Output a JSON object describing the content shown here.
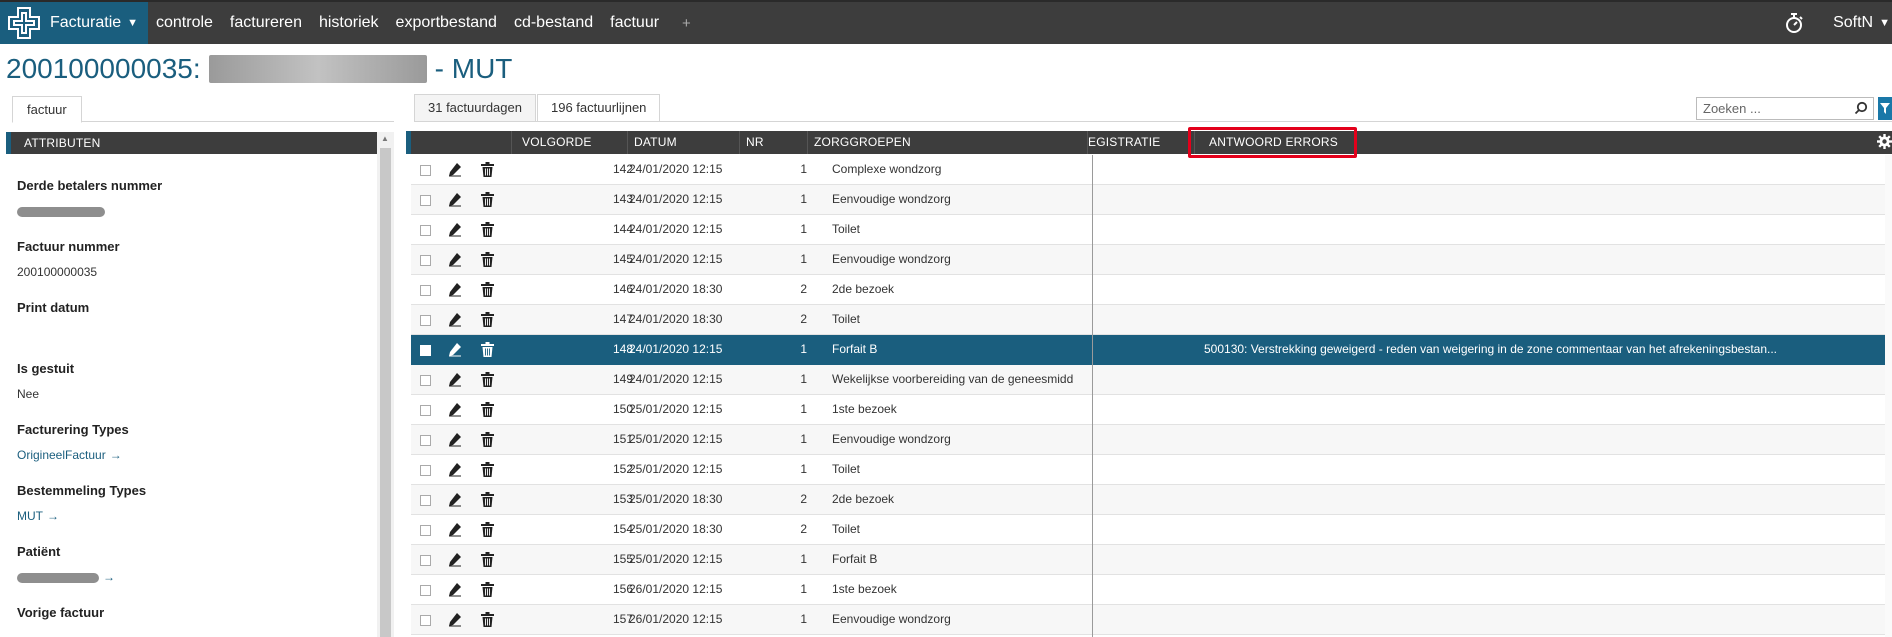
{
  "nav": {
    "brand": "Facturatie",
    "items": [
      "controle",
      "factureren",
      "historiek",
      "exportbestand",
      "cd-bestand",
      "factuur"
    ],
    "plus": "+",
    "user": "SoftN"
  },
  "title": {
    "prefix": "200100000035:",
    "suffix": "- MUT"
  },
  "left_panel": {
    "tab": "factuur",
    "section": "ATTRIBUTEN",
    "attributes": [
      {
        "label": "Derde betalers nummer",
        "value": "",
        "redacted": true
      },
      {
        "label": "Factuur nummer",
        "value": "200100000035"
      },
      {
        "label": "Print datum",
        "value": ""
      },
      {
        "label": "Is gestuit",
        "value": "Nee"
      },
      {
        "label": "Facturering Types",
        "value": "OrigineelFactuur",
        "link": true
      },
      {
        "label": "Bestemmeling Types",
        "value": "MUT",
        "link": true
      },
      {
        "label": "Patiënt",
        "value": "",
        "redacted": true,
        "link": true
      },
      {
        "label": "Vorige factuur",
        "value": ""
      }
    ]
  },
  "right_panel": {
    "tabs": [
      "31 factuurdagen",
      "196 factuurlijnen"
    ],
    "active_tab": 1,
    "search_placeholder": "Zoeken ...",
    "columns": [
      "VOLGORDE",
      "DATUM",
      "NR",
      "ZORGGROEPEN",
      "EGISTRATIE",
      "ANTWOORD ERRORS"
    ],
    "rows": [
      {
        "volgorde": "142",
        "datum": "24/01/2020 12:15",
        "nr": "1",
        "zorggroep": "Complexe wondzorg",
        "error": ""
      },
      {
        "volgorde": "143",
        "datum": "24/01/2020 12:15",
        "nr": "1",
        "zorggroep": "Eenvoudige wondzorg",
        "error": ""
      },
      {
        "volgorde": "144",
        "datum": "24/01/2020 12:15",
        "nr": "1",
        "zorggroep": "Toilet",
        "error": ""
      },
      {
        "volgorde": "145",
        "datum": "24/01/2020 12:15",
        "nr": "1",
        "zorggroep": "Eenvoudige wondzorg",
        "error": ""
      },
      {
        "volgorde": "146",
        "datum": "24/01/2020 18:30",
        "nr": "2",
        "zorggroep": "2de bezoek",
        "error": ""
      },
      {
        "volgorde": "147",
        "datum": "24/01/2020 18:30",
        "nr": "2",
        "zorggroep": "Toilet",
        "error": ""
      },
      {
        "volgorde": "148",
        "datum": "24/01/2020 12:15",
        "nr": "1",
        "zorggroep": "Forfait B",
        "error": "500130: Verstrekking geweigerd - reden van weigering in de zone commentaar van het afrekeningsbestan...",
        "selected": true
      },
      {
        "volgorde": "149",
        "datum": "24/01/2020 12:15",
        "nr": "1",
        "zorggroep": "Wekelijkse voorbereiding van de geneesmidd",
        "error": ""
      },
      {
        "volgorde": "150",
        "datum": "25/01/2020 12:15",
        "nr": "1",
        "zorggroep": "1ste bezoek",
        "error": ""
      },
      {
        "volgorde": "151",
        "datum": "25/01/2020 12:15",
        "nr": "1",
        "zorggroep": "Eenvoudige wondzorg",
        "error": ""
      },
      {
        "volgorde": "152",
        "datum": "25/01/2020 12:15",
        "nr": "1",
        "zorggroep": "Toilet",
        "error": ""
      },
      {
        "volgorde": "153",
        "datum": "25/01/2020 18:30",
        "nr": "2",
        "zorggroep": "2de bezoek",
        "error": ""
      },
      {
        "volgorde": "154",
        "datum": "25/01/2020 18:30",
        "nr": "2",
        "zorggroep": "Toilet",
        "error": ""
      },
      {
        "volgorde": "155",
        "datum": "25/01/2020 12:15",
        "nr": "1",
        "zorggroep": "Forfait B",
        "error": ""
      },
      {
        "volgorde": "156",
        "datum": "26/01/2020 12:15",
        "nr": "1",
        "zorggroep": "1ste bezoek",
        "error": ""
      },
      {
        "volgorde": "157",
        "datum": "26/01/2020 12:15",
        "nr": "1",
        "zorggroep": "Eenvoudige wondzorg",
        "error": ""
      }
    ]
  },
  "colors": {
    "brand": "#1a5e7e",
    "nav_bg": "#3d3d3d",
    "highlight": "#e3001b",
    "selected_row": "#1a5e7e"
  },
  "icons": [
    "logo-icon",
    "chevron-down-icon",
    "stopwatch-icon",
    "search-icon",
    "filter-icon",
    "gear-icon",
    "pencil-icon",
    "trash-icon",
    "checkbox"
  ]
}
